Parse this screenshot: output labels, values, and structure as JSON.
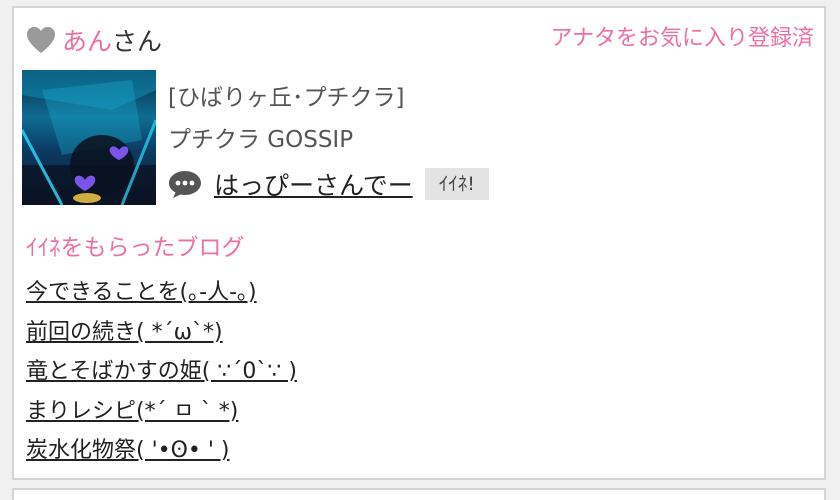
{
  "user": {
    "name": "あん",
    "suffix": "さん"
  },
  "favorite_status": "アナタをお気に入り登録済",
  "shop": {
    "area": "[ひばりヶ丘･プチクラ]",
    "name": "プチクラ GOSSIP"
  },
  "post": {
    "title": "はっぴーさんでー",
    "like_button": "ｲｲﾈ!"
  },
  "liked_section": {
    "heading": "ｲｲﾈをもらったブログ",
    "items": [
      "今できることを(｡-人-｡)",
      "前回の続き( *´ω`*)",
      "竜とそばかすの姫( ∵´0`∵ )",
      "まりレシピ(*´ ㅁ ` *)",
      "炭水化物祭( '•ʘ• ' )"
    ]
  },
  "colors": {
    "accent": "#ee6fa6",
    "text": "#333333",
    "border": "#d4d4d4",
    "button_bg": "#e3e3e3"
  },
  "icons": {
    "heart": "heart-icon",
    "chat": "speech-bubble-icon"
  }
}
